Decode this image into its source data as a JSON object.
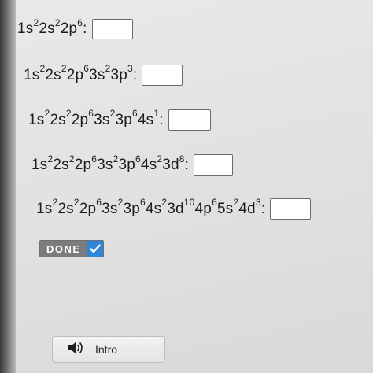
{
  "questions": [
    {
      "parts": [
        {
          "t": "1s"
        },
        {
          "s": "2"
        },
        {
          "t": "2s"
        },
        {
          "s": "2"
        },
        {
          "t": "2p"
        },
        {
          "s": "6"
        }
      ],
      "colon": ":",
      "answer": ""
    },
    {
      "parts": [
        {
          "t": "1s"
        },
        {
          "s": "2"
        },
        {
          "t": "2s"
        },
        {
          "s": "2"
        },
        {
          "t": "2p"
        },
        {
          "s": "6"
        },
        {
          "t": "3s"
        },
        {
          "s": "2"
        },
        {
          "t": "3p"
        },
        {
          "s": "3"
        }
      ],
      "colon": ":",
      "answer": ""
    },
    {
      "parts": [
        {
          "t": "1s"
        },
        {
          "s": "2"
        },
        {
          "t": "2s"
        },
        {
          "s": "2"
        },
        {
          "t": "2p"
        },
        {
          "s": "6"
        },
        {
          "t": "3s"
        },
        {
          "s": "2"
        },
        {
          "t": "3p"
        },
        {
          "s": "6"
        },
        {
          "t": "4s"
        },
        {
          "s": "1"
        }
      ],
      "colon": ":",
      "answer": ""
    },
    {
      "parts": [
        {
          "t": "1s"
        },
        {
          "s": "2"
        },
        {
          "t": "2s"
        },
        {
          "s": "2"
        },
        {
          "t": "2p"
        },
        {
          "s": "6"
        },
        {
          "t": "3s"
        },
        {
          "s": "2"
        },
        {
          "t": "3p"
        },
        {
          "s": "6"
        },
        {
          "t": "4s"
        },
        {
          "s": "2"
        },
        {
          "t": "3d"
        },
        {
          "s": "8"
        }
      ],
      "colon": ":",
      "answer": ""
    },
    {
      "parts": [
        {
          "t": "1s"
        },
        {
          "s": "2"
        },
        {
          "t": "2s"
        },
        {
          "s": "2"
        },
        {
          "t": "2p"
        },
        {
          "s": "6"
        },
        {
          "t": "3s"
        },
        {
          "s": "2"
        },
        {
          "t": "3p"
        },
        {
          "s": "6"
        },
        {
          "t": "4s"
        },
        {
          "s": "2"
        },
        {
          "t": "3d"
        },
        {
          "s": "10"
        },
        {
          "t": "4p"
        },
        {
          "s": "6"
        },
        {
          "t": "5s"
        },
        {
          "s": "2"
        },
        {
          "t": "4d"
        },
        {
          "s": "3"
        }
      ],
      "colon": ":",
      "answer": ""
    }
  ],
  "done_button": {
    "label": "DONE",
    "icon": "checkmark-icon",
    "accent_color": "#2f86d6"
  },
  "intro_button": {
    "label": "Intro",
    "icon": "speaker-icon"
  }
}
